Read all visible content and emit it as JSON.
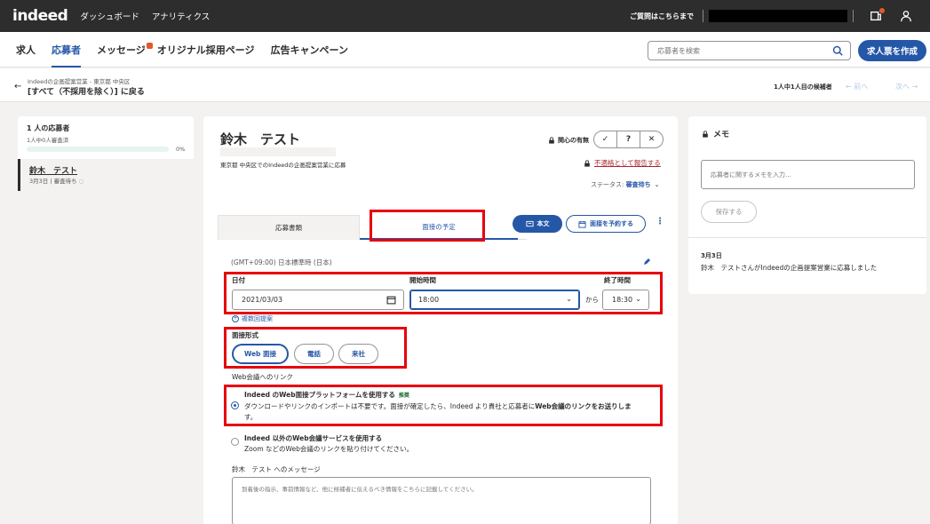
{
  "topbar": {
    "logo": "indeed",
    "nav": [
      "ダッシュボード",
      "アナリティクス"
    ],
    "help_text": "ご質問はこちらまで"
  },
  "subnav": {
    "tabs": [
      "求人",
      "応募者",
      "メッセージ",
      "オリジナル採用ページ",
      "広告キャンペーン"
    ],
    "active_tab": "応募者",
    "search_placeholder": "応募者を検索",
    "post_job_label": "求人票を作成"
  },
  "breadcrumb": {
    "small": "Indeedの企画提案営業 - 東京都 中央区",
    "main": "[すべて（不採用を除く）] に戻る",
    "candidate_count": "1人中1人目の候補者",
    "prev": "← 前へ",
    "next": "次へ →"
  },
  "left_panel": {
    "count_title": "1 人の応募者",
    "sub": "1人中0人審査済",
    "percent_text": "0%",
    "progress": 0,
    "items": [
      {
        "name": "鈴木　テスト",
        "status": "3月3日 | 審査待ち"
      }
    ]
  },
  "candidate": {
    "name": "鈴木　テスト",
    "job_line": "東京都 中央区でのIndeedの企画提案営業に応募",
    "interest_label": "関心の有無",
    "rating_buttons": [
      "✓",
      "?",
      "✕"
    ],
    "report_label": "不適格として報告する",
    "status_label": "ステータス:",
    "status_value": "審査待ち"
  },
  "tabs": {
    "docs": "応募書類",
    "interview": "面接の予定",
    "resume_btn": "本文",
    "schedule_btn": "面接を予約する"
  },
  "schedule": {
    "timezone": "(GMT+09:00) 日本標準時 (日本)",
    "date_label": "日付",
    "date_value": "2021/03/03",
    "start_label": "開始時間",
    "start_value": "18:00",
    "from": "から",
    "end_label": "終了時間",
    "end_value": "18:30",
    "multi_link": "複数回提案",
    "format_label": "面接形式",
    "formats": [
      "Web 面接",
      "電話",
      "来社"
    ],
    "selected_format": "Web 面接",
    "link_label": "Web会議へのリンク",
    "option1_title": "Indeed のWeb面接プラットフォームを使用する",
    "option1_badge": "推奨",
    "option1_desc_a": "ダウンロードやリンクのインポートは不要です。面接が確定したら、Indeed より貴社と応募者に",
    "option1_desc_b": "Web会議のリンクをお送りしま",
    "option1_desc_c": "す。",
    "option2_title": "Indeed 以外のWeb会議サービスを使用する",
    "option2_desc": "Zoom などのWeb会議のリンクを貼り付けてください。",
    "message_label": "鈴木　テスト へのメッセージ",
    "message_placeholder": "到着後の指示、事前情報など、他に候補者に伝えるべき情報をこちらに記載してください。"
  },
  "memo": {
    "title": "メモ",
    "placeholder": "応募者に関するメモを入力...",
    "save_label": "保存する",
    "activity_date": "3月3日",
    "activity_text": "鈴木　テストさんがIndeedの企画提案営業に応募しました"
  },
  "colors": {
    "brand_blue": "#2557a7",
    "highlight_red": "#e8000b",
    "topbar_bg": "#2d2d2d"
  }
}
